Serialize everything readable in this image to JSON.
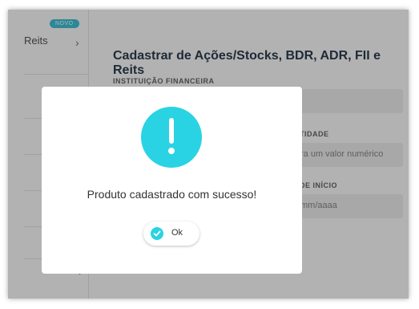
{
  "sidebar": {
    "badge": "NOVO",
    "item_label": "Reits"
  },
  "main": {
    "title": "Cadastrar de Ações/Stocks, BDR, ADR, FII e Reits",
    "institution_label": "INSTITUIÇÃO FINANCEIRA",
    "quantity_label": "TIDADE",
    "quantity_placeholder": "ra um valor numérico",
    "start_date_label": "DE INÍCIO",
    "start_date_placeholder": "mm/aaaa"
  },
  "dialog": {
    "message": "Produto cadastrado com sucesso!",
    "ok_label": "Ok",
    "accent_color": "#2ad3e3"
  }
}
